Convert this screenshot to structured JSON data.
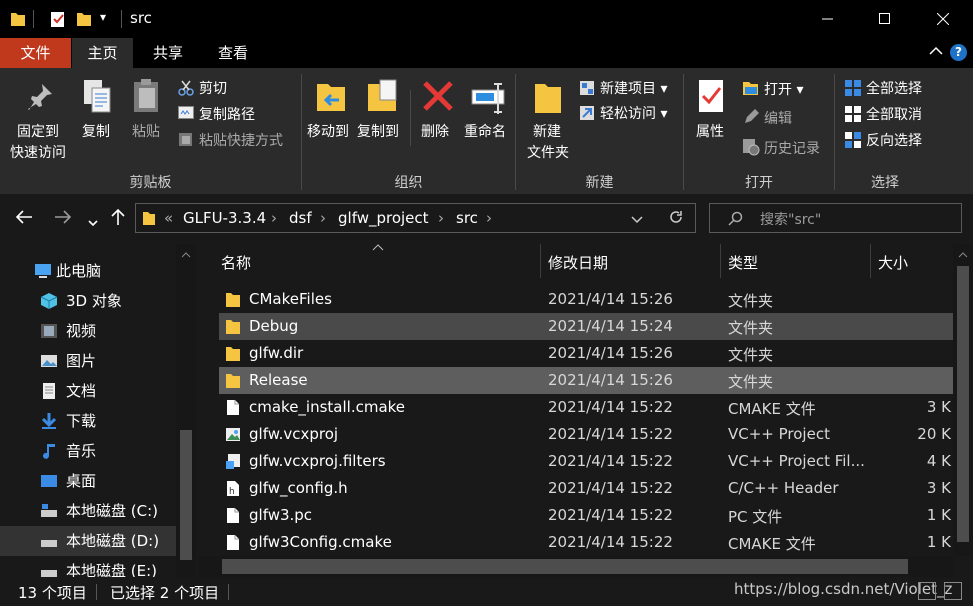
{
  "window": {
    "title": "src",
    "minimize_icon": "minimize-icon",
    "maximize_icon": "maximize-icon",
    "close_icon": "close-icon",
    "qa_dropdown": "▾"
  },
  "ribbon_tabs": {
    "file": "文件",
    "home": "主页",
    "share": "共享",
    "view": "查看"
  },
  "ribbon": {
    "clipboard": {
      "title": "剪贴板",
      "pin_line1": "固定到",
      "pin_line2": "快速访问",
      "copy": "复制",
      "paste": "粘贴",
      "cut": "剪切",
      "copy_path": "复制路径",
      "paste_shortcut": "粘贴快捷方式"
    },
    "organize": {
      "title": "组织",
      "move_to": "移动到",
      "copy_to": "复制到",
      "delete": "删除",
      "rename": "重命名"
    },
    "new": {
      "title": "新建",
      "new_folder_line1": "新建",
      "new_folder_line2": "文件夹",
      "new_item": "新建项目",
      "easy_access": "轻松访问"
    },
    "open": {
      "title": "打开",
      "properties": "属性",
      "open": "打开",
      "edit": "编辑",
      "history": "历史记录"
    },
    "select": {
      "title": "选择",
      "select_all": "全部选择",
      "select_none": "全部取消",
      "invert": "反向选择"
    }
  },
  "address": {
    "overflow": "«",
    "crumbs": [
      "GLFU-3.3.4",
      "dsf",
      "glfw_project",
      "src"
    ],
    "separator": "›",
    "search_placeholder": "搜索\"src\""
  },
  "nav_pane": {
    "items": [
      {
        "label": "此电脑",
        "icon": "computer-icon"
      },
      {
        "label": "3D 对象",
        "icon": "3d-objects-icon"
      },
      {
        "label": "视频",
        "icon": "video-icon"
      },
      {
        "label": "图片",
        "icon": "pictures-icon"
      },
      {
        "label": "文档",
        "icon": "documents-icon"
      },
      {
        "label": "下载",
        "icon": "download-icon"
      },
      {
        "label": "音乐",
        "icon": "music-icon"
      },
      {
        "label": "桌面",
        "icon": "desktop-icon"
      },
      {
        "label": "本地磁盘 (C:)",
        "icon": "drive-icon"
      },
      {
        "label": "本地磁盘 (D:)",
        "icon": "drive-icon"
      },
      {
        "label": "本地磁盘 (E:)",
        "icon": "drive-icon"
      }
    ],
    "selected_index": 9
  },
  "file_list": {
    "columns": [
      "名称",
      "修改日期",
      "类型",
      "大小"
    ],
    "rows": [
      {
        "name": "CMakeFiles",
        "date": "2021/4/14 15:26",
        "type": "文件夹",
        "size": "",
        "icon": "folder-icon",
        "selected": false
      },
      {
        "name": "Debug",
        "date": "2021/4/14 15:24",
        "type": "文件夹",
        "size": "",
        "icon": "folder-icon",
        "selected": true
      },
      {
        "name": "glfw.dir",
        "date": "2021/4/14 15:26",
        "type": "文件夹",
        "size": "",
        "icon": "folder-icon",
        "selected": false
      },
      {
        "name": "Release",
        "date": "2021/4/14 15:26",
        "type": "文件夹",
        "size": "",
        "icon": "folder-icon",
        "selected": true
      },
      {
        "name": "cmake_install.cmake",
        "date": "2021/4/14 15:22",
        "type": "CMAKE 文件",
        "size": "3 K",
        "icon": "file-icon",
        "selected": false
      },
      {
        "name": "glfw.vcxproj",
        "date": "2021/4/14 15:22",
        "type": "VC++ Project",
        "size": "20 K",
        "icon": "vcxproj-icon",
        "selected": false
      },
      {
        "name": "glfw.vcxproj.filters",
        "date": "2021/4/14 15:22",
        "type": "VC++ Project Fil...",
        "size": "4 K",
        "icon": "vcxproj-filters-icon",
        "selected": false
      },
      {
        "name": "glfw_config.h",
        "date": "2021/4/14 15:22",
        "type": "C/C++ Header",
        "size": "3 K",
        "icon": "header-file-icon",
        "selected": false
      },
      {
        "name": "glfw3.pc",
        "date": "2021/4/14 15:22",
        "type": "PC 文件",
        "size": "1 K",
        "icon": "file-icon",
        "selected": false
      },
      {
        "name": "glfw3Config.cmake",
        "date": "2021/4/14 15:22",
        "type": "CMAKE 文件",
        "size": "1 K",
        "icon": "file-icon",
        "selected": false
      }
    ]
  },
  "status": {
    "count": "13 个项目",
    "selected": "已选择 2 个项目",
    "watermark": "https://blog.csdn.net/Violet_z"
  },
  "colors": {
    "accent_file_tab": "#c0391d",
    "folder": "#f5c542",
    "selection": "#4a4a4a"
  }
}
